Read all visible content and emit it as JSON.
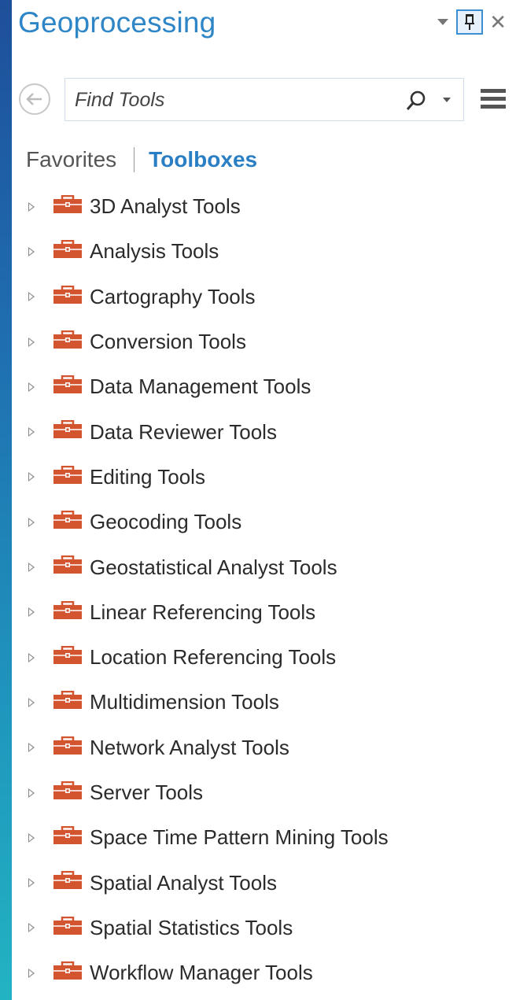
{
  "pane": {
    "title": "Geoprocessing"
  },
  "search": {
    "placeholder": "Find Tools"
  },
  "tabs": {
    "favorites": "Favorites",
    "toolboxes": "Toolboxes",
    "active": "Toolboxes"
  },
  "toolboxes": [
    {
      "label": "3D Analyst Tools"
    },
    {
      "label": "Analysis Tools"
    },
    {
      "label": "Cartography Tools"
    },
    {
      "label": "Conversion Tools"
    },
    {
      "label": "Data Management Tools"
    },
    {
      "label": "Data Reviewer Tools"
    },
    {
      "label": "Editing Tools"
    },
    {
      "label": "Geocoding Tools"
    },
    {
      "label": "Geostatistical Analyst Tools"
    },
    {
      "label": "Linear Referencing Tools"
    },
    {
      "label": "Location Referencing Tools"
    },
    {
      "label": "Multidimension Tools"
    },
    {
      "label": "Network Analyst Tools"
    },
    {
      "label": "Server Tools"
    },
    {
      "label": "Space Time Pattern Mining Tools"
    },
    {
      "label": "Spatial Analyst Tools"
    },
    {
      "label": "Spatial Statistics Tools"
    },
    {
      "label": "Workflow Manager Tools"
    }
  ],
  "colors": {
    "title_blue": "#2f86c6",
    "toolbox_orange": "#d2552f",
    "active_tab_blue": "#2a7fc4",
    "desktop_gradient": [
      "#1e4f9a",
      "#22b3c2"
    ]
  },
  "icons": {
    "back": "back-arrow-icon",
    "search": "search-icon",
    "menu": "hamburger-menu-icon",
    "pin": "pin-icon",
    "close": "close-icon",
    "toolbox": "toolbox-icon",
    "expander": "expand-triangle-icon"
  }
}
